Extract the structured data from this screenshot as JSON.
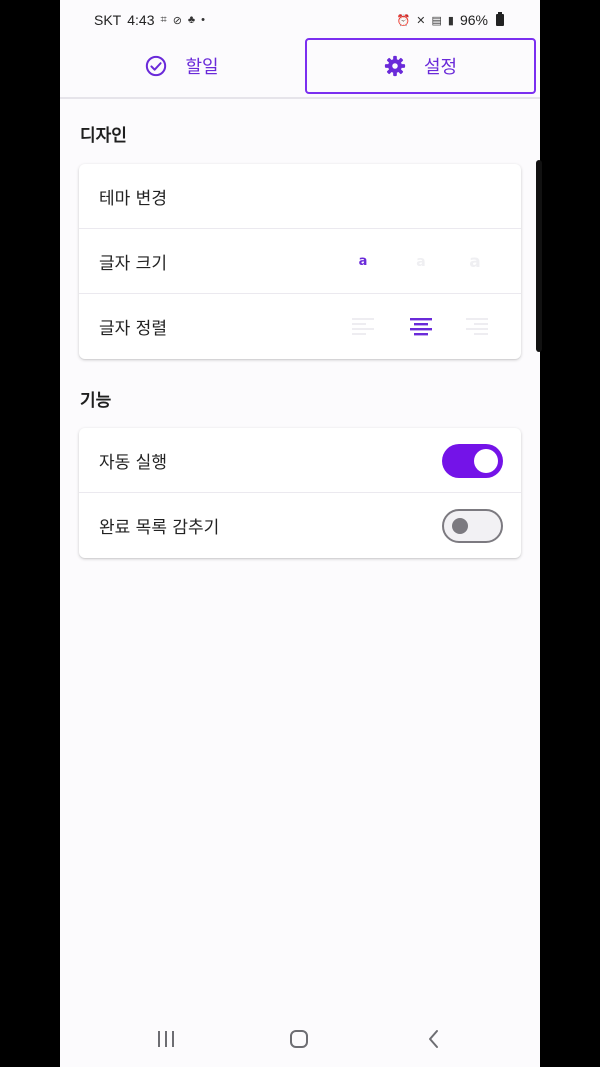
{
  "status_bar": {
    "carrier": "SKT",
    "time": "4:43",
    "battery": "96%"
  },
  "tabs": [
    {
      "label": "할일",
      "icon": "check-circle-icon",
      "selected": false
    },
    {
      "label": "설정",
      "icon": "gear-icon",
      "selected": true
    }
  ],
  "sections": {
    "design": {
      "title": "디자인",
      "rows": {
        "theme": "테마 변경",
        "font_size": "글자 크기",
        "font_align": "글자 정렬"
      },
      "font_size_options": [
        "a",
        "a",
        "a"
      ],
      "font_size_selected": 0,
      "align_options": [
        "align-left-icon",
        "align-center-icon",
        "align-right-icon"
      ],
      "align_selected": 1
    },
    "features": {
      "title": "기능",
      "rows": {
        "autostart": {
          "label": "자동 실행",
          "on": true
        },
        "hide_done": {
          "label": "완료 목록 감추기",
          "on": false
        }
      }
    }
  },
  "colors": {
    "accent": "#7413e8",
    "accent_text": "#6a2ad9",
    "background": "#fcfbfd"
  }
}
